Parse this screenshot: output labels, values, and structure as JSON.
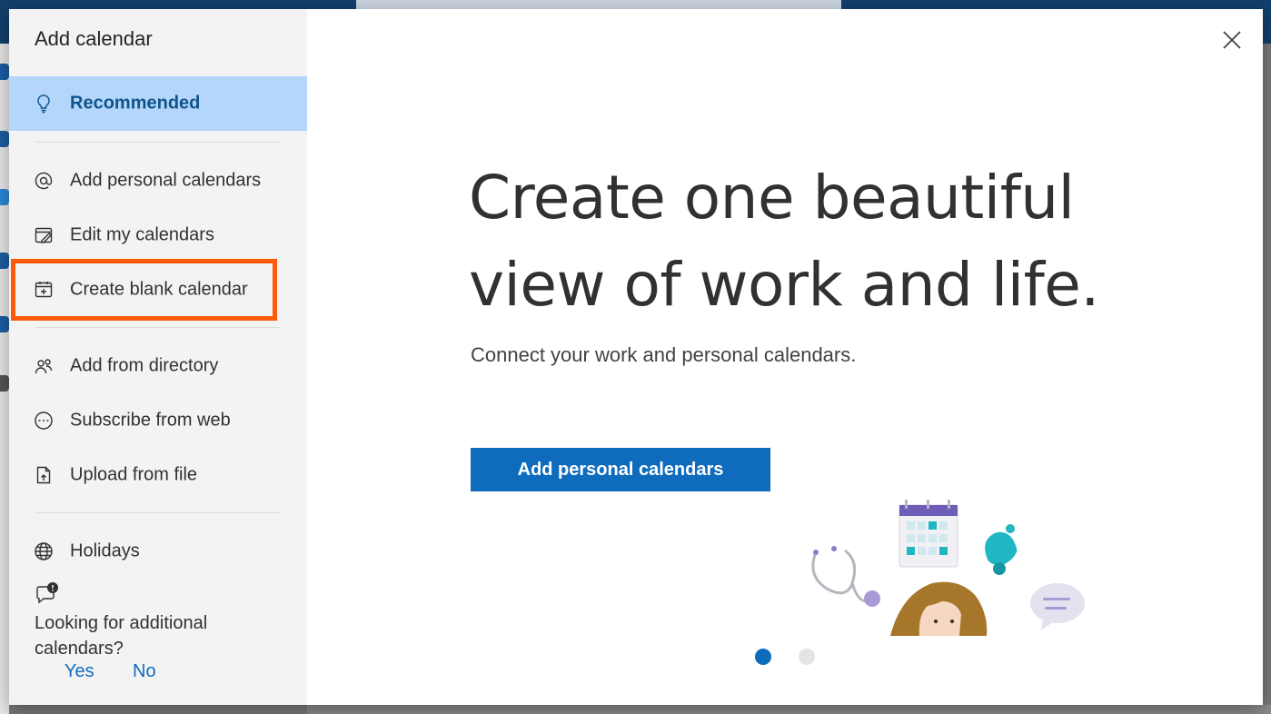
{
  "dialog": {
    "title": "Add calendar",
    "close_icon": "close-icon"
  },
  "sidebar": {
    "items": [
      {
        "label": "Recommended",
        "icon": "lightbulb-icon",
        "selected": true
      },
      {
        "label": "Add personal calendars",
        "icon": "at-sign-icon"
      },
      {
        "label": "Edit my calendars",
        "icon": "edit-calendar-icon"
      },
      {
        "label": "Create blank calendar",
        "icon": "calendar-add-icon",
        "highlighted": true
      },
      {
        "label": "Add from directory",
        "icon": "people-icon"
      },
      {
        "label": "Subscribe from web",
        "icon": "link-icon"
      },
      {
        "label": "Upload from file",
        "icon": "document-icon"
      },
      {
        "label": "Holidays",
        "icon": "globe-icon"
      }
    ],
    "feedback": {
      "question": "Looking for additional calendars?",
      "yes_label": "Yes",
      "no_label": "No"
    }
  },
  "main": {
    "headline": "Create one beautiful view of work and life.",
    "subtext": "Connect your work and personal calendars.",
    "primary_button": "Add personal calendars",
    "pager": {
      "count": 2,
      "active": 1
    }
  },
  "colors": {
    "accent": "#0f6cbd",
    "selected_bg": "#b4d6fa",
    "highlight_border": "#ff5a0a"
  }
}
